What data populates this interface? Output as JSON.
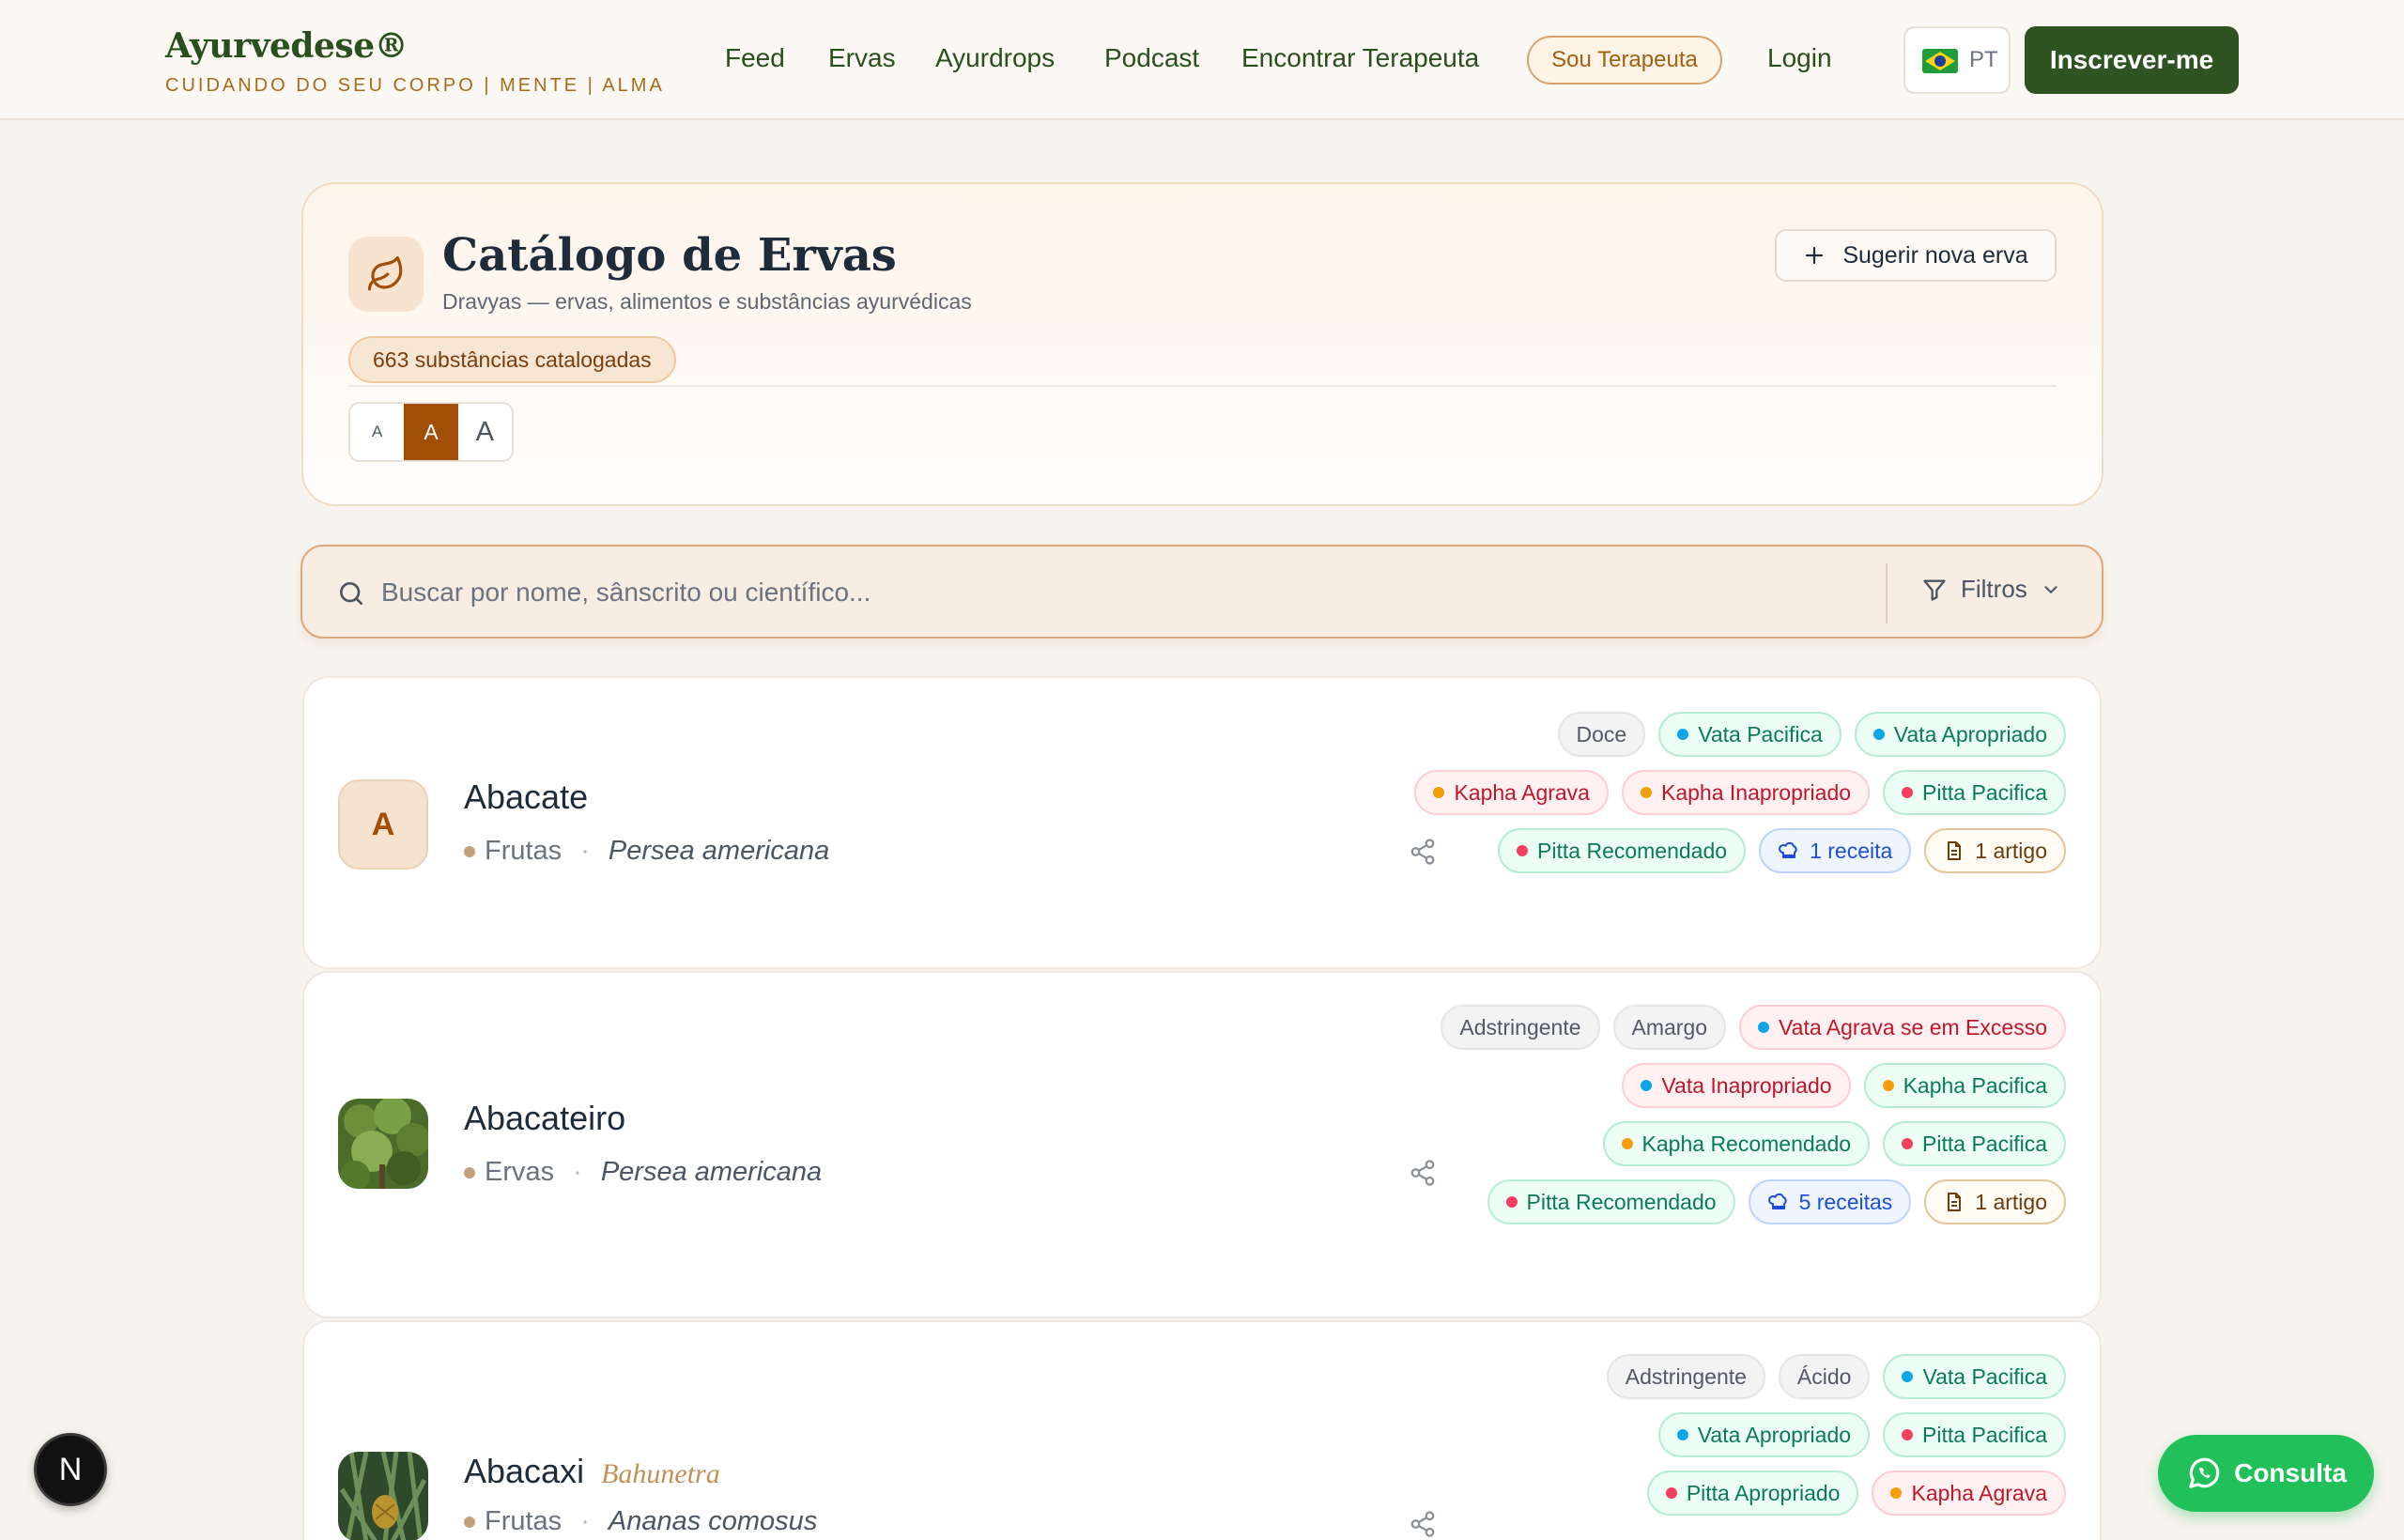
{
  "header": {
    "brand": "Ayurvedese®",
    "tagline": "CUIDANDO DO SEU CORPO | MENTE | ALMA",
    "nav": [
      "Feed",
      "Ervas",
      "Ayurdrops",
      "Podcast",
      "Encontrar Terapeuta"
    ],
    "therapist_button": "Sou Terapeuta",
    "login": "Login",
    "language": "PT",
    "signup_button": "Inscrever-me"
  },
  "catalog": {
    "title": "Catálogo de Ervas",
    "subtitle": "Dravyas — ervas, alimentos e substâncias ayurvédicas",
    "suggest_button": "Sugerir nova erva",
    "count_label": "663 substâncias catalogadas",
    "font_sizes": [
      "A",
      "A",
      "A"
    ],
    "font_size_selected": 1
  },
  "search": {
    "placeholder": "Buscar por nome, sânscrito ou científico...",
    "value": "",
    "filters_label": "Filtros"
  },
  "herbs": [
    {
      "name": "Abacate",
      "sanskrit": "",
      "avatar_letter": "A",
      "category": "Frutas",
      "scientific": "Persea americana",
      "tags": [
        {
          "label": "Doce",
          "kind": "taste"
        },
        {
          "label": "Vata Pacifica",
          "kind": "good",
          "dot": "#0ea5e9"
        },
        {
          "label": "Vata Apropriado",
          "kind": "good",
          "dot": "#0ea5e9"
        },
        {
          "label": "Kapha Agrava",
          "kind": "bad",
          "dot": "#f59e0b"
        },
        {
          "label": "Kapha Inapropriado",
          "kind": "bad",
          "dot": "#f59e0b"
        },
        {
          "label": "Pitta Pacifica",
          "kind": "good",
          "dot": "#f43f5e"
        },
        {
          "label": "Pitta Recomendado",
          "kind": "good",
          "dot": "#f43f5e"
        },
        {
          "label": "1 receita",
          "kind": "recipe"
        },
        {
          "label": "1 artigo",
          "kind": "article"
        }
      ]
    },
    {
      "name": "Abacateiro",
      "sanskrit": "",
      "avatar_letter": "",
      "category": "Ervas",
      "scientific": "Persea americana",
      "tags": [
        {
          "label": "Adstringente",
          "kind": "taste"
        },
        {
          "label": "Amargo",
          "kind": "taste"
        },
        {
          "label": "Vata Agrava se em Excesso",
          "kind": "bad",
          "dot": "#0ea5e9"
        },
        {
          "label": "Vata Inapropriado",
          "kind": "bad",
          "dot": "#0ea5e9"
        },
        {
          "label": "Kapha Pacifica",
          "kind": "good",
          "dot": "#f59e0b"
        },
        {
          "label": "Kapha Recomendado",
          "kind": "good",
          "dot": "#f59e0b"
        },
        {
          "label": "Pitta Pacifica",
          "kind": "good",
          "dot": "#f43f5e"
        },
        {
          "label": "Pitta Recomendado",
          "kind": "good",
          "dot": "#f43f5e"
        },
        {
          "label": "5 receitas",
          "kind": "recipe"
        },
        {
          "label": "1 artigo",
          "kind": "article"
        }
      ]
    },
    {
      "name": "Abacaxi",
      "sanskrit": "Bahunetra",
      "avatar_letter": "",
      "category": "Frutas",
      "scientific": "Ananas comosus",
      "tags": [
        {
          "label": "Adstringente",
          "kind": "taste"
        },
        {
          "label": "Ácido",
          "kind": "taste"
        },
        {
          "label": "Vata Pacifica",
          "kind": "good",
          "dot": "#0ea5e9"
        },
        {
          "label": "Vata Apropriado",
          "kind": "good",
          "dot": "#0ea5e9"
        },
        {
          "label": "Pitta Pacifica",
          "kind": "good",
          "dot": "#f43f5e"
        },
        {
          "label": "Pitta Apropriado",
          "kind": "good",
          "dot": "#f43f5e"
        },
        {
          "label": "Kapha Agrava",
          "kind": "bad",
          "dot": "#f59e0b"
        }
      ]
    }
  ],
  "floating": {
    "dev_badge": "N",
    "whatsapp_label": "Consulta"
  },
  "colors": {
    "brand_green": "#2f5321",
    "accent_orange": "#a34e06",
    "whatsapp": "#21c05a"
  }
}
